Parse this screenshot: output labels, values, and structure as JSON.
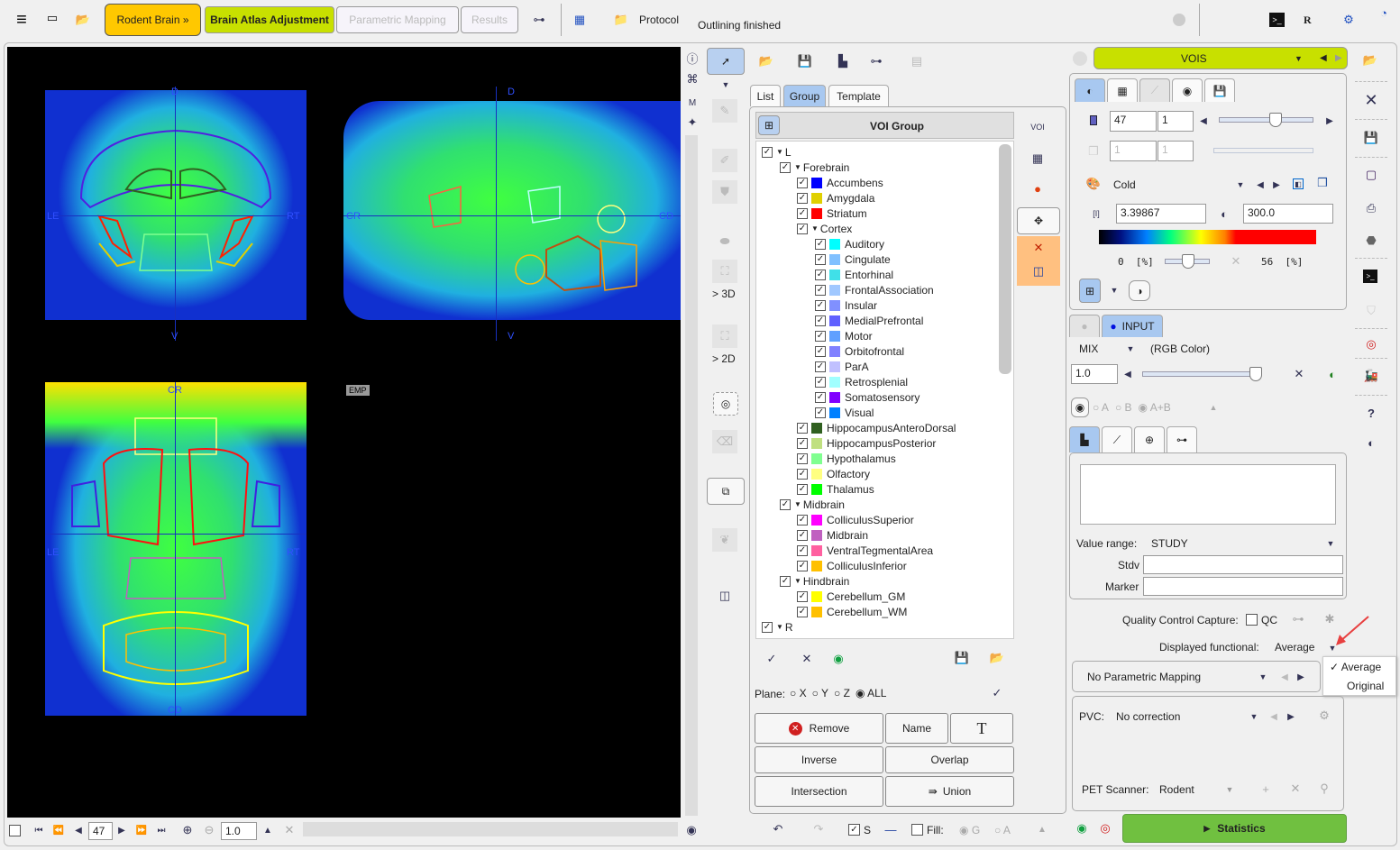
{
  "topbar": {
    "menu_icon": "hamburger-icon",
    "workflow_buttons": [
      "Rodent Brain »",
      "Brain Atlas Adjustment",
      "Parametric Mapping",
      "Results"
    ],
    "protocol_label": "Protocol",
    "status": "Outlining finished",
    "r_label": "R"
  },
  "viewer": {
    "coronal": {
      "top": "D",
      "bottom": "V",
      "left": "LE",
      "right": "RT"
    },
    "sagittal": {
      "top": "D",
      "bottom": "V",
      "left": "CR",
      "right": "CD"
    },
    "axial": {
      "top": "CR",
      "bottom": "CD",
      "left": "LE",
      "right": "RT"
    },
    "emp_badge": "EMP",
    "bottom": {
      "slice": "47",
      "zoom": "1.0"
    }
  },
  "tools": {
    "label_3d": "> 3D",
    "label_2d": "> 2D"
  },
  "voi_panel": {
    "tabs": [
      "List",
      "Group",
      "Template"
    ],
    "active_tab": "Group",
    "header": "VOI Group",
    "tree": [
      {
        "label": "L",
        "level": 0,
        "expander": true
      },
      {
        "label": "Forebrain",
        "level": 1,
        "expander": true
      },
      {
        "label": "Accumbens",
        "level": 2,
        "color": "#0000ff"
      },
      {
        "label": "Amygdala",
        "level": 2,
        "color": "#e0d000"
      },
      {
        "label": "Striatum",
        "level": 2,
        "color": "#ff0000"
      },
      {
        "label": "Cortex",
        "level": 2,
        "expander": true
      },
      {
        "label": "Auditory",
        "level": 3,
        "color": "#00ffff"
      },
      {
        "label": "Cingulate",
        "level": 3,
        "color": "#80c0ff"
      },
      {
        "label": "Entorhinal",
        "level": 3,
        "color": "#40e0e8"
      },
      {
        "label": "FrontalAssociation",
        "level": 3,
        "color": "#a0c8ff"
      },
      {
        "label": "Insular",
        "level": 3,
        "color": "#8090ff"
      },
      {
        "label": "MedialPrefrontal",
        "level": 3,
        "color": "#6060ff"
      },
      {
        "label": "Motor",
        "level": 3,
        "color": "#60a0ff"
      },
      {
        "label": "Orbitofrontal",
        "level": 3,
        "color": "#8080ff"
      },
      {
        "label": "ParA",
        "level": 3,
        "color": "#c0c0ff"
      },
      {
        "label": "Retrosplenial",
        "level": 3,
        "color": "#a0ffff"
      },
      {
        "label": "Somatosensory",
        "level": 3,
        "color": "#8000ff"
      },
      {
        "label": "Visual",
        "level": 3,
        "color": "#0080ff"
      },
      {
        "label": "HippocampusAnteroDorsal",
        "level": 2,
        "color": "#306020"
      },
      {
        "label": "HippocampusPosterior",
        "level": 2,
        "color": "#c0e080"
      },
      {
        "label": "Hypothalamus",
        "level": 2,
        "color": "#80ff90"
      },
      {
        "label": "Olfactory",
        "level": 2,
        "color": "#ffff80"
      },
      {
        "label": "Thalamus",
        "level": 2,
        "color": "#00ff00"
      },
      {
        "label": "Midbrain",
        "level": 1,
        "expander": true
      },
      {
        "label": "ColliculusSuperior",
        "level": 2,
        "color": "#ff00ff"
      },
      {
        "label": "Midbrain",
        "level": 2,
        "color": "#c060c0"
      },
      {
        "label": "VentralTegmentalArea",
        "level": 2,
        "color": "#ff60a0"
      },
      {
        "label": "ColliculusInferior",
        "level": 2,
        "color": "#ffc000"
      },
      {
        "label": "Hindbrain",
        "level": 1,
        "expander": true
      },
      {
        "label": "Cerebellum_GM",
        "level": 2,
        "color": "#ffff00"
      },
      {
        "label": "Cerebellum_WM",
        "level": 2,
        "color": "#ffc000"
      },
      {
        "label": "R",
        "level": 0,
        "expander": true
      }
    ],
    "plane_label": "Plane:",
    "planes": [
      "X",
      "Y",
      "Z",
      "ALL"
    ],
    "plane_selected": "ALL",
    "buttons": {
      "remove": "Remove",
      "name": "Name",
      "text": "T",
      "inverse": "Inverse",
      "overlap": "Overlap",
      "intersection": "Intersection",
      "union": "Union"
    },
    "bottom": {
      "s_label": "S",
      "fill_label": "Fill:",
      "g_label": "G",
      "a_label": "A"
    }
  },
  "right_panel": {
    "vois_label": "VOIS",
    "slice": "47",
    "slice2": "1",
    "frame": "1",
    "frame2": "1",
    "slice_slider": 0.6,
    "colormap": "Cold",
    "min_value": "3.39867",
    "max_value": "300.0",
    "lower_pct": "0",
    "upper_pct": "56",
    "pct_unit": "[%]",
    "input_label": "INPUT",
    "mix_label": "MIX",
    "mix_mode": "(RGB Color)",
    "mix_value": "1.0",
    "radio": [
      "A",
      "B",
      "A+B"
    ],
    "radio_selected": "A+B",
    "value_range_label": "Value range:",
    "value_range": "STUDY",
    "stdv_label": "Stdv",
    "marker_label": "Marker",
    "qc_label": "Quality Control Capture:",
    "qc_checkbox": "QC",
    "displayed_label": "Displayed functional:",
    "displayed_value": "Average",
    "dropdown_options": [
      "Average",
      "Original"
    ],
    "dropdown_selected": "Average",
    "param_mapping": "No Parametric Mapping",
    "pvc_label": "PVC:",
    "pvc_value": "No correction",
    "scanner_label": "PET Scanner:",
    "scanner_value": "Rodent",
    "statistics": "Statistics",
    "help": "?",
    "accent": "#c8e000"
  }
}
